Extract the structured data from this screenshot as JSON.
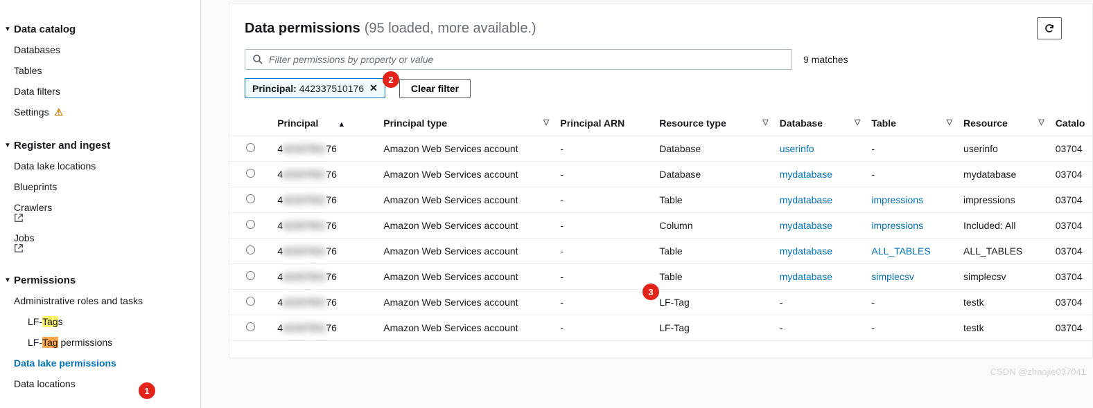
{
  "sidebar": {
    "groups": [
      {
        "label": "Data catalog",
        "items": [
          {
            "label": "Databases"
          },
          {
            "label": "Tables"
          },
          {
            "label": "Data filters"
          },
          {
            "label": "Settings",
            "warn": true
          }
        ]
      },
      {
        "label": "Register and ingest",
        "items": [
          {
            "label": "Data lake locations"
          },
          {
            "label": "Blueprints"
          },
          {
            "label": "Crawlers",
            "ext": true
          },
          {
            "label": "Jobs",
            "ext": true
          }
        ]
      },
      {
        "label": "Permissions",
        "items": [
          {
            "label": "Administrative roles and tasks"
          },
          {
            "label_pre": "LF-",
            "label_hl": "Tag",
            "label_post": "s",
            "indent": true,
            "hl": "yellow"
          },
          {
            "label_pre": "LF-",
            "label_hl": "Tag",
            "label_post": " permissions",
            "indent": true,
            "hl": "orange"
          },
          {
            "label": "Data lake permissions",
            "active": true
          },
          {
            "label": "Data locations"
          }
        ]
      }
    ]
  },
  "header": {
    "title": "Data permissions",
    "subtitle": "(95 loaded, more available.)"
  },
  "search": {
    "placeholder": "Filter permissions by property or value",
    "matches": "9 matches"
  },
  "chip": {
    "key": "Principal:",
    "value": "442337510176"
  },
  "clear_label": "Clear filter",
  "columns": {
    "principal": "Principal",
    "ptype": "Principal type",
    "arn": "Principal ARN",
    "rtype": "Resource type",
    "db": "Database",
    "table": "Table",
    "resource": "Resource",
    "catalog": "Catalo"
  },
  "rows": [
    {
      "principal_pre": "4",
      "principal_mid": "42337501",
      "principal_post": "76",
      "ptype": "Amazon Web Services account",
      "arn": "-",
      "rtype": "Database",
      "db": "userinfo",
      "table": "-",
      "resource": "userinfo",
      "catalog": "03704"
    },
    {
      "principal_pre": "4",
      "principal_mid": "42337501",
      "principal_post": "76",
      "ptype": "Amazon Web Services account",
      "arn": "-",
      "rtype": "Database",
      "db": "mydatabase",
      "table": "-",
      "resource": "mydatabase",
      "catalog": "03704"
    },
    {
      "principal_pre": "4",
      "principal_mid": "42337501",
      "principal_post": "76",
      "ptype": "Amazon Web Services account",
      "arn": "-",
      "rtype": "Table",
      "db": "mydatabase",
      "table": "impressions",
      "resource": "impressions",
      "catalog": "03704"
    },
    {
      "principal_pre": "4",
      "principal_mid": "42337501",
      "principal_post": "76",
      "ptype": "Amazon Web Services account",
      "arn": "-",
      "rtype": "Column",
      "db": "mydatabase",
      "table": "impressions",
      "resource": "Included: All",
      "catalog": "03704"
    },
    {
      "principal_pre": "4",
      "principal_mid": "42337501",
      "principal_post": "76",
      "ptype": "Amazon Web Services account",
      "arn": "-",
      "rtype": "Table",
      "db": "mydatabase",
      "table": "ALL_TABLES",
      "resource": "ALL_TABLES",
      "catalog": "03704"
    },
    {
      "principal_pre": "4",
      "principal_mid": "42337501",
      "principal_post": "76",
      "ptype": "Amazon Web Services account",
      "arn": "-",
      "rtype": "Table",
      "db": "mydatabase",
      "table": "simplecsv",
      "resource": "simplecsv",
      "catalog": "03704"
    },
    {
      "principal_pre": "4",
      "principal_mid": "42337501",
      "principal_post": "76",
      "ptype": "Amazon Web Services account",
      "arn": "-",
      "rtype": "LF-Tag",
      "db": "-",
      "table": "-",
      "resource": "testk",
      "catalog": "03704"
    },
    {
      "principal_pre": "4",
      "principal_mid": "42337501",
      "principal_post": "76",
      "ptype": "Amazon Web Services account",
      "arn": "-",
      "rtype": "LF-Tag",
      "db": "-",
      "table": "-",
      "resource": "testk",
      "catalog": "03704"
    }
  ],
  "annotations": {
    "a1": "1",
    "a2": "2",
    "a3": "3"
  },
  "watermark": "CSDN @zhaojie037041"
}
